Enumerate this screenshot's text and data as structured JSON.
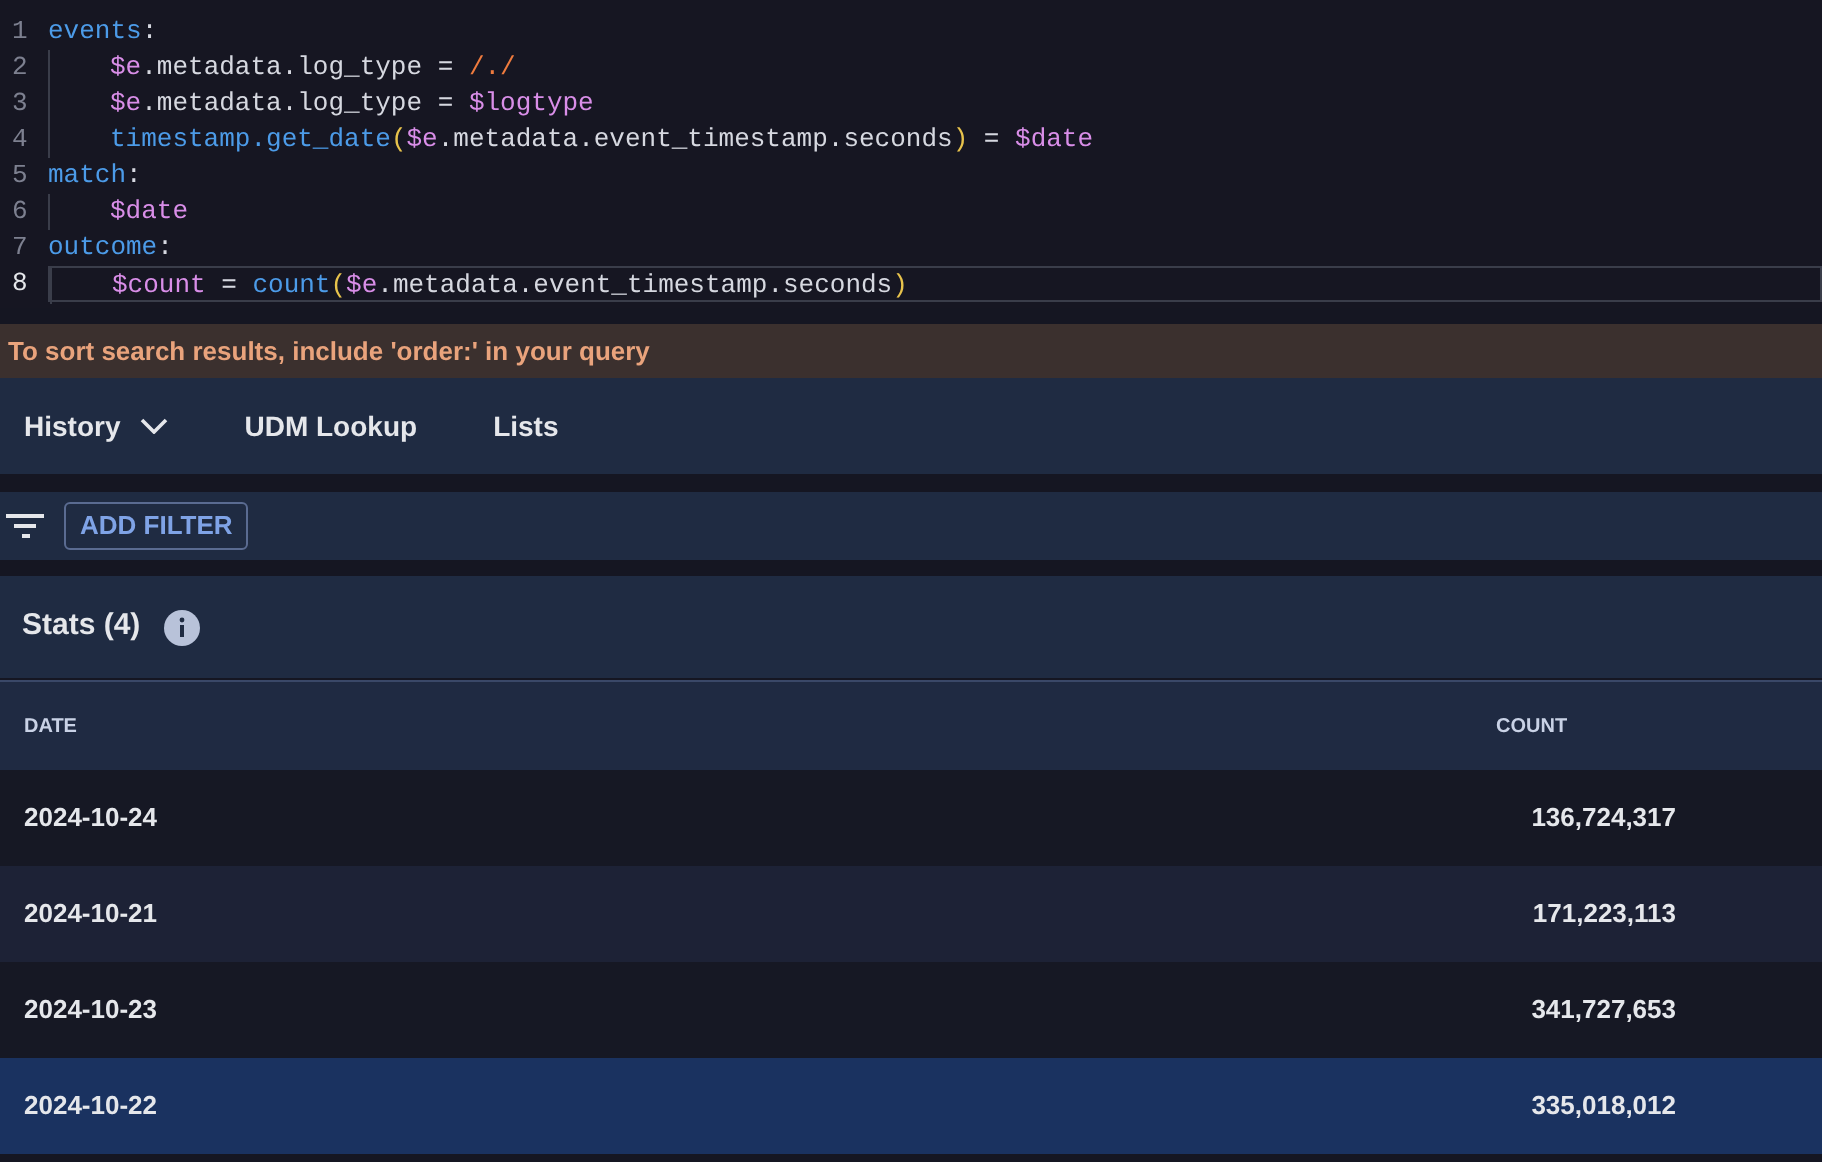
{
  "editor": {
    "lines": [
      {
        "number": "1",
        "current": false,
        "tokens": [
          {
            "text": "events",
            "kind": "keyword"
          },
          {
            "text": ":",
            "kind": "plain"
          }
        ],
        "children": [
          {
            "number": "2",
            "current": false,
            "tokens": [
              {
                "text": "$e",
                "kind": "variable"
              },
              {
                "text": ".metadata.log_type = ",
                "kind": "plain"
              },
              {
                "text": "/./",
                "kind": "regex"
              }
            ]
          },
          {
            "number": "3",
            "current": false,
            "tokens": [
              {
                "text": "$e",
                "kind": "variable"
              },
              {
                "text": ".metadata.log_type = ",
                "kind": "plain"
              },
              {
                "text": "$logtype",
                "kind": "variable"
              }
            ]
          },
          {
            "number": "4",
            "current": false,
            "tokens": [
              {
                "text": "timestamp.get_date",
                "kind": "function"
              },
              {
                "text": "(",
                "kind": "paren"
              },
              {
                "text": "$e",
                "kind": "variable"
              },
              {
                "text": ".metadata.event_timestamp.seconds",
                "kind": "plain"
              },
              {
                "text": ")",
                "kind": "paren"
              },
              {
                "text": " = ",
                "kind": "plain"
              },
              {
                "text": "$date",
                "kind": "variable"
              }
            ]
          }
        ]
      },
      {
        "number": "5",
        "current": false,
        "tokens": [
          {
            "text": "match",
            "kind": "keyword"
          },
          {
            "text": ":",
            "kind": "plain"
          }
        ],
        "children": [
          {
            "number": "6",
            "current": false,
            "tokens": [
              {
                "text": "$date",
                "kind": "variable"
              }
            ]
          }
        ]
      },
      {
        "number": "7",
        "current": false,
        "tokens": [
          {
            "text": "outcome",
            "kind": "keyword"
          },
          {
            "text": ":",
            "kind": "plain"
          }
        ],
        "children": [
          {
            "number": "8",
            "current": true,
            "tokens": [
              {
                "text": "$count",
                "kind": "variable"
              },
              {
                "text": " = ",
                "kind": "plain"
              },
              {
                "text": "count",
                "kind": "function"
              },
              {
                "text": "(",
                "kind": "paren"
              },
              {
                "text": "$e",
                "kind": "variable"
              },
              {
                "text": ".metadata.event_timestamp.seconds",
                "kind": "plain"
              },
              {
                "text": ")",
                "kind": "paren"
              }
            ]
          }
        ]
      }
    ]
  },
  "notice": "To sort search results, include 'order:' in your query",
  "tabs": [
    {
      "label": "History",
      "dropdown": true
    },
    {
      "label": "UDM Lookup",
      "dropdown": false
    },
    {
      "label": "Lists",
      "dropdown": false
    }
  ],
  "filter_bar": {
    "button": "ADD FILTER"
  },
  "stats": {
    "title": "Stats (4)",
    "columns": [
      "DATE",
      "COUNT"
    ],
    "rows": [
      {
        "date": "2024-10-24",
        "count": "136,724,317",
        "selected": false
      },
      {
        "date": "2024-10-21",
        "count": "171,223,113",
        "selected": false
      },
      {
        "date": "2024-10-23",
        "count": "341,727,653",
        "selected": false
      },
      {
        "date": "2024-10-22",
        "count": "335,018,012",
        "selected": true
      }
    ]
  }
}
